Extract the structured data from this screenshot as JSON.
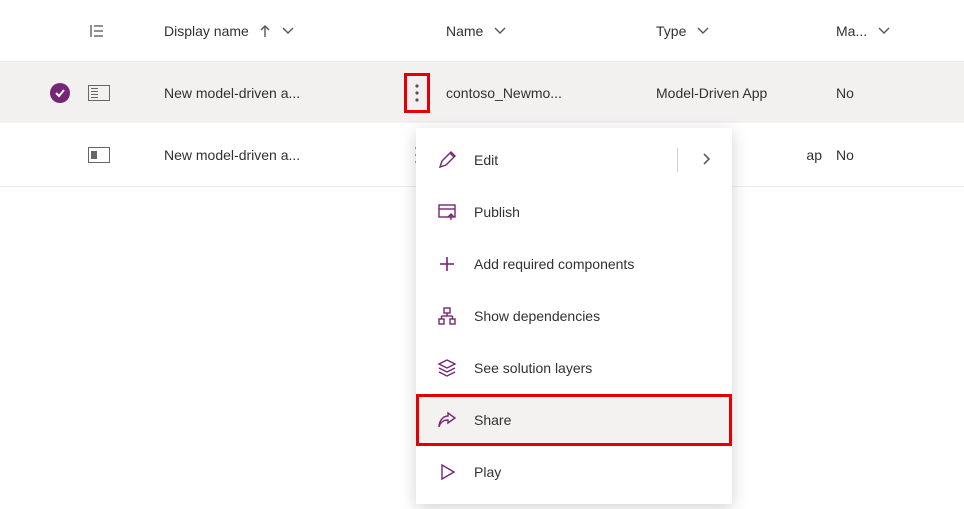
{
  "columns": {
    "display_name": "Display name",
    "name": "Name",
    "type": "Type",
    "managed": "Ma..."
  },
  "rows": [
    {
      "display_name": "New model-driven a...",
      "name": "contoso_Newmo...",
      "type": "Model-Driven App",
      "managed": "No",
      "selected": true
    },
    {
      "display_name": "New model-driven a...",
      "name": "",
      "type_suffix": "ap",
      "managed": "No",
      "selected": false
    }
  ],
  "menu": {
    "edit": "Edit",
    "publish": "Publish",
    "add_required": "Add required components",
    "show_dependencies": "Show dependencies",
    "see_layers": "See solution layers",
    "share": "Share",
    "play": "Play"
  }
}
